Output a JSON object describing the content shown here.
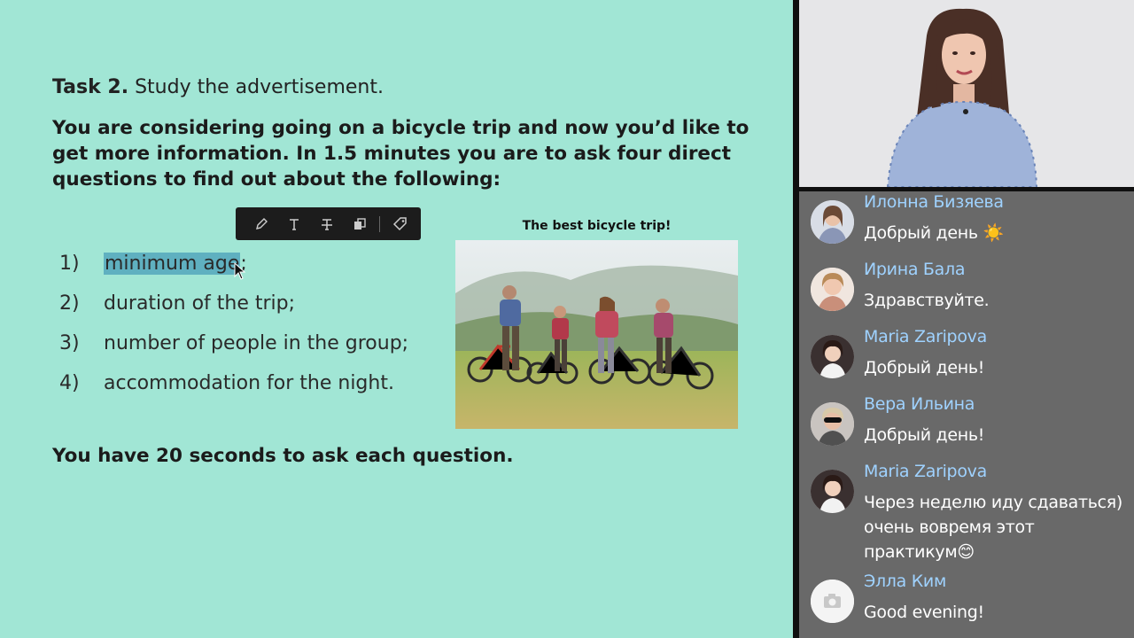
{
  "slide": {
    "task_label": "Task 2.",
    "task_text": " Study the advertisement.",
    "instructions": "You are considering going on a bicycle trip and now you’d like to get more information. In 1.5 minutes you are to ask four direct questions to find out about the following:",
    "items": [
      {
        "num": "1)",
        "text_highlighted": "minimum age",
        "text_rest": ";"
      },
      {
        "num": "2)",
        "text": "duration of the trip;"
      },
      {
        "num": "3)",
        "text": "number of people in the group;"
      },
      {
        "num": "4)",
        "text": "accommodation for the night."
      }
    ],
    "ad_title": "The best bicycle trip!",
    "footer": "You have 20 seconds to ask each question.",
    "toolbar_icons": [
      "pen-icon",
      "text-icon",
      "strikethrough-icon",
      "copy-icon",
      "tag-icon"
    ],
    "highlight_color": "#5fb0c0"
  },
  "chat": {
    "messages": [
      {
        "name": "Илонна Бизяева",
        "text": "Добрый день ☀️"
      },
      {
        "name": "Ирина Бала",
        "text": "Здравствуйте."
      },
      {
        "name": "Maria Zaripova",
        "text": "Добрый день!"
      },
      {
        "name": "Вера Ильина",
        "text": "Добрый день!"
      },
      {
        "name": "Maria Zaripova",
        "text_line1": "Через неделю иду сдаваться)",
        "text_line2": "очень вовремя этот",
        "text_line3": "практикум😊"
      },
      {
        "name": "Элла Ким",
        "text": "Good evening!"
      }
    ],
    "name_color": "#9fd2ff"
  }
}
